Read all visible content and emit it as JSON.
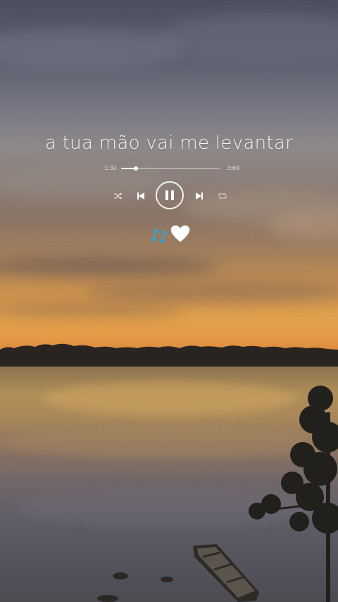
{
  "lyric": {
    "text": "a tua mão vai me levantar"
  },
  "player": {
    "elapsed": "1:32",
    "duration": "3:60",
    "progress_fraction": 0.15,
    "controls": [
      "shuffle-icon",
      "previous-icon",
      "pause-icon",
      "next-icon",
      "repeat-icon"
    ],
    "state": "playing"
  },
  "decoration": {
    "icons": [
      "music-notes-icon",
      "white-heart-icon"
    ],
    "notes_color": "#2aa7d8",
    "heart_color": "#ffffff"
  }
}
